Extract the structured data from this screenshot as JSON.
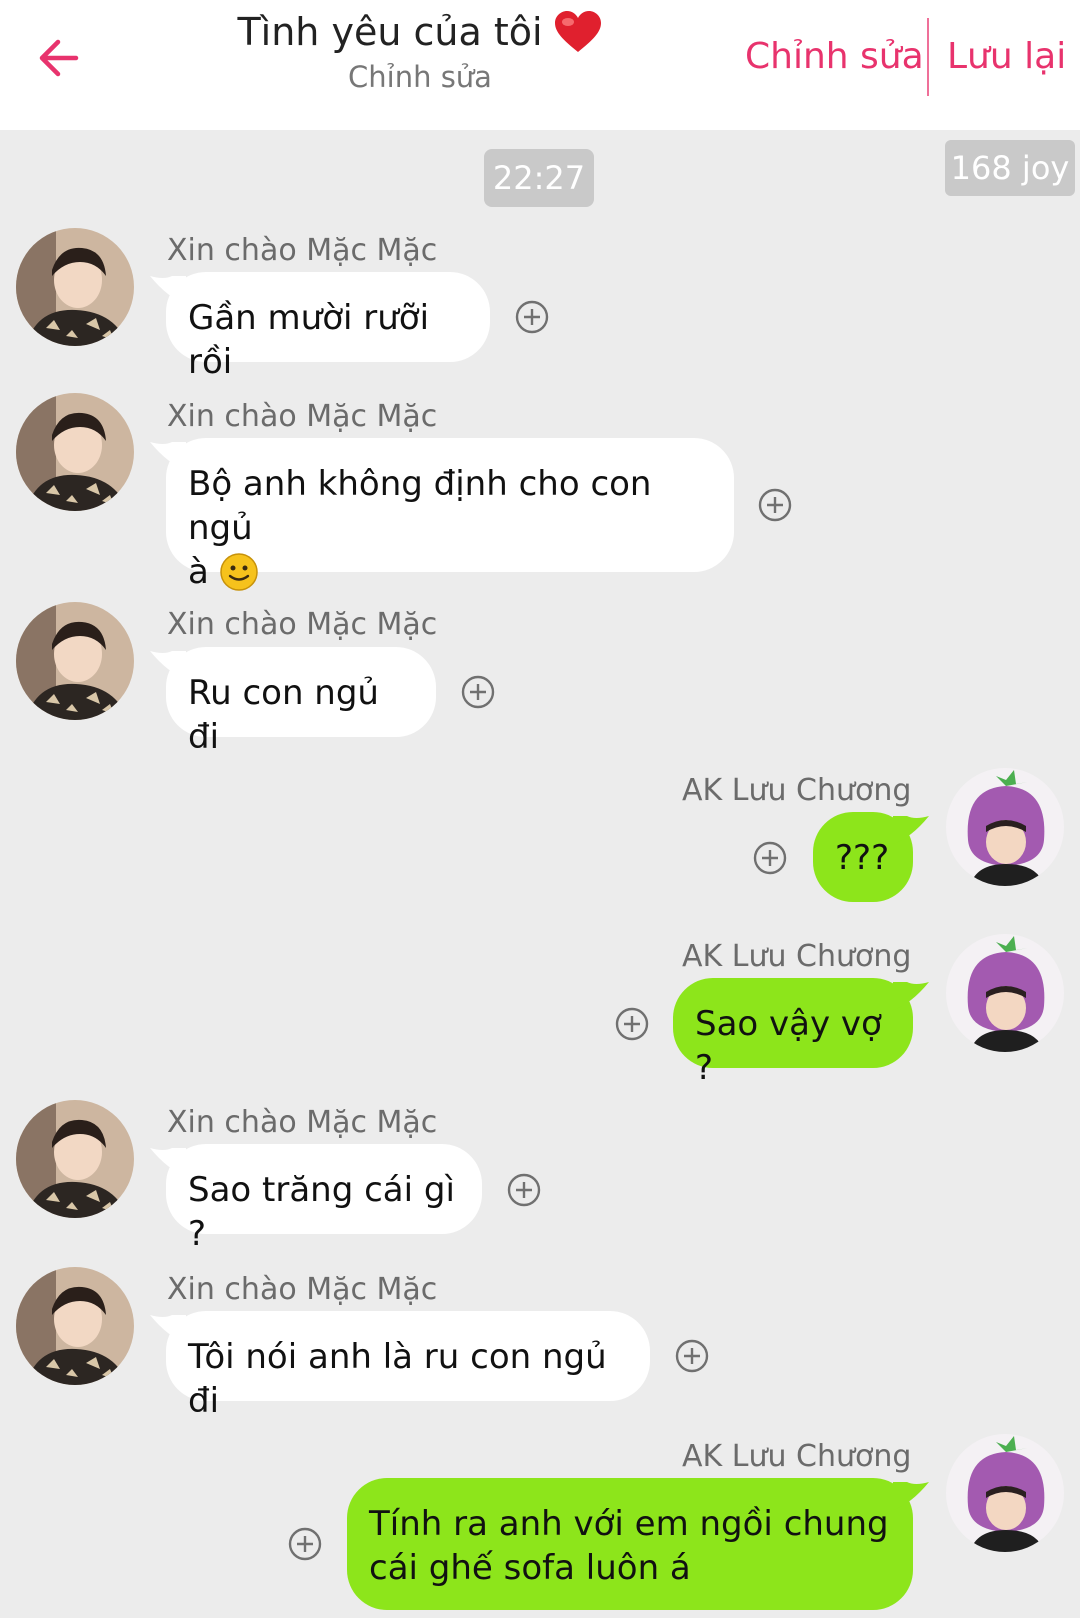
{
  "header": {
    "title": "Tình yêu của tôi",
    "subtitle": "Chỉnh sửa",
    "edit_label": "Chỉnh sửa",
    "save_label": "Lưu lại",
    "back_icon": "arrow-left-icon",
    "title_icon": "heart-icon"
  },
  "chat": {
    "time": "22:27",
    "joy": "168 joy",
    "messages": [
      {
        "side": "in",
        "sender": "Xin chào Mặc Mặc",
        "text": "Gần mười rưỡi rồi"
      },
      {
        "side": "in",
        "sender": "Xin chào Mặc Mặc",
        "text_line1": "Bộ anh không định cho con ngủ",
        "text_line2": "à",
        "emoji": "smiley-emoji"
      },
      {
        "side": "in",
        "sender": "Xin chào Mặc Mặc",
        "text": "Ru con ngủ đi"
      },
      {
        "side": "out",
        "sender": "AK Lưu Chương",
        "text": "???"
      },
      {
        "side": "out",
        "sender": "AK Lưu Chương",
        "text": "Sao vậy vợ ?"
      },
      {
        "side": "in",
        "sender": "Xin chào Mặc Mặc",
        "text": "Sao trăng cái gì ?"
      },
      {
        "side": "in",
        "sender": "Xin chào Mặc Mặc",
        "text": "Tôi nói anh là ru con ngủ đi"
      },
      {
        "side": "out",
        "sender": "AK Lưu Chương",
        "text_line1": "Tính ra anh với em ngồi chung",
        "text_line2": "cái ghế sofa luôn á"
      }
    ]
  },
  "colors": {
    "accent": "#e8336d",
    "outgoing_bubble": "#8de51b",
    "incoming_bubble": "#ffffff",
    "background": "#ececec"
  }
}
